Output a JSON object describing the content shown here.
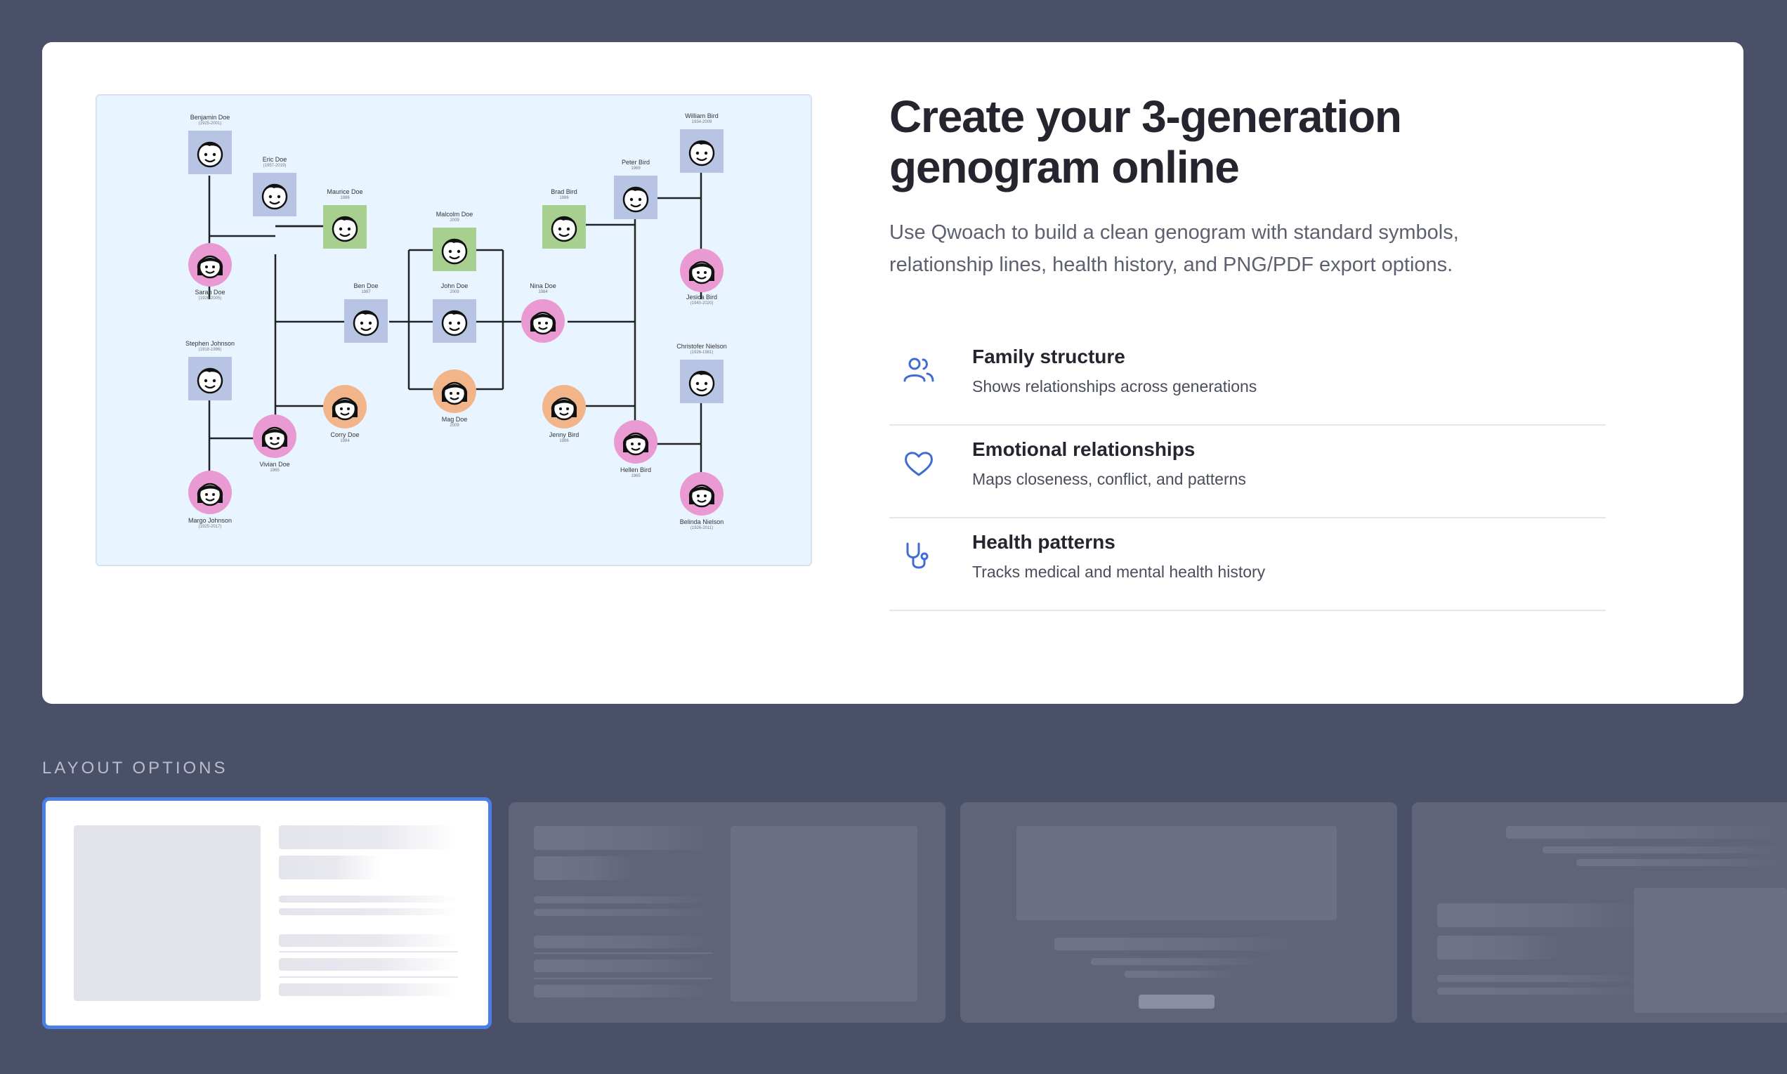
{
  "hero": {
    "headline_line1": "Create your 3-generation",
    "headline_line2": "genogram online",
    "subtitle_line1": "Use Qwoach to build a clean genogram with standard symbols,",
    "subtitle_line2": "relationship lines, health history, and PNG/PDF export options."
  },
  "features": [
    {
      "title": "Family structure",
      "desc": "Shows relationships across generations",
      "icon": "users-icon"
    },
    {
      "title": "Emotional relationships",
      "desc": "Maps closeness, conflict, and patterns",
      "icon": "heart-icon"
    },
    {
      "title": "Health patterns",
      "desc": "Tracks medical and mental health history",
      "icon": "stethoscope-icon"
    }
  ],
  "genogram": {
    "people": [
      {
        "name": "Benjamin Doe",
        "years": "(1925-2001)"
      },
      {
        "name": "Eric Doe",
        "years": "(1957-2019)"
      },
      {
        "name": "Maurice Doe",
        "years": "1986"
      },
      {
        "name": "Sarah Doe",
        "years": "(1926-2005)"
      },
      {
        "name": "Malcolm Doe",
        "years": "2009"
      },
      {
        "name": "Ben Doe",
        "years": "1987"
      },
      {
        "name": "John Doe",
        "years": "2009"
      },
      {
        "name": "Stephen Johnson",
        "years": "(1918-1996)"
      },
      {
        "name": "Corry Doe",
        "years": "1984"
      },
      {
        "name": "Vivian Doe",
        "years": "1965"
      },
      {
        "name": "Mag Doe",
        "years": "2009"
      },
      {
        "name": "Margo Johnson",
        "years": "(1925-2017)"
      },
      {
        "name": "Brad Bird",
        "years": "1986"
      },
      {
        "name": "Nina Doe",
        "years": "1984"
      },
      {
        "name": "Peter Bird",
        "years": "1969"
      },
      {
        "name": "William Bird",
        "years": "1934-2009"
      },
      {
        "name": "Jesica Bird",
        "years": "(1940-2020)"
      },
      {
        "name": "Christofer Nielson",
        "years": "(1926-1981)"
      },
      {
        "name": "Jenny Bird",
        "years": "1986"
      },
      {
        "name": "Hellen Bird",
        "years": "1965"
      },
      {
        "name": "Belinda Nielson",
        "years": "(1926-2011)"
      }
    ]
  },
  "layout": {
    "label": "LAYOUT OPTIONS"
  },
  "colors": {
    "background": "#4b5069",
    "accent": "#4a7fe8",
    "icon": "#3f6bd6"
  }
}
